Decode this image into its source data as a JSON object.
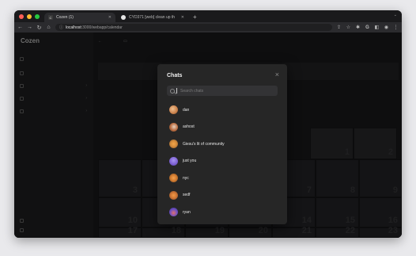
{
  "browser": {
    "tabs": [
      {
        "icon": "C",
        "label": "Cozen (1)",
        "active": true
      },
      {
        "icon": "gh",
        "label": "CYD371 [web] clean up th",
        "active": false
      }
    ],
    "url_host": "localhost",
    "url_path": ":3000/webapp/calendar"
  },
  "app": {
    "brand": "Cozen",
    "sidebar": [
      "",
      "",
      "",
      "",
      ""
    ],
    "bottom": [
      "",
      ""
    ]
  },
  "calendar": {
    "top_numbers": [
      "1",
      "2"
    ],
    "rows": [
      [
        "3",
        "",
        "",
        "",
        "7",
        "8",
        "9"
      ],
      [
        "10",
        "",
        "",
        "",
        "14",
        "15",
        "16"
      ],
      [
        "17",
        "18",
        "19",
        "20",
        "21",
        "22",
        "23"
      ]
    ]
  },
  "modal": {
    "title": "Chats",
    "close": "×",
    "search_placeholder": "Search chats",
    "chats": [
      {
        "name": "dan",
        "color": "#c9804a"
      },
      {
        "name": "ashost",
        "color": "#b86a3e"
      },
      {
        "name": "Giesu's lit of community",
        "color": "#d28a3a"
      },
      {
        "name": "just you",
        "color": "#7b5fd1"
      },
      {
        "name": "nyc",
        "color": "#d07a2e"
      },
      {
        "name": "sedf",
        "color": "#cc7433"
      },
      {
        "name": "ryan",
        "color": "#6a4ec4"
      }
    ]
  },
  "colors": {
    "close_dot": "#ff5f57",
    "min_dot": "#febc2e",
    "max_dot": "#28c840"
  }
}
